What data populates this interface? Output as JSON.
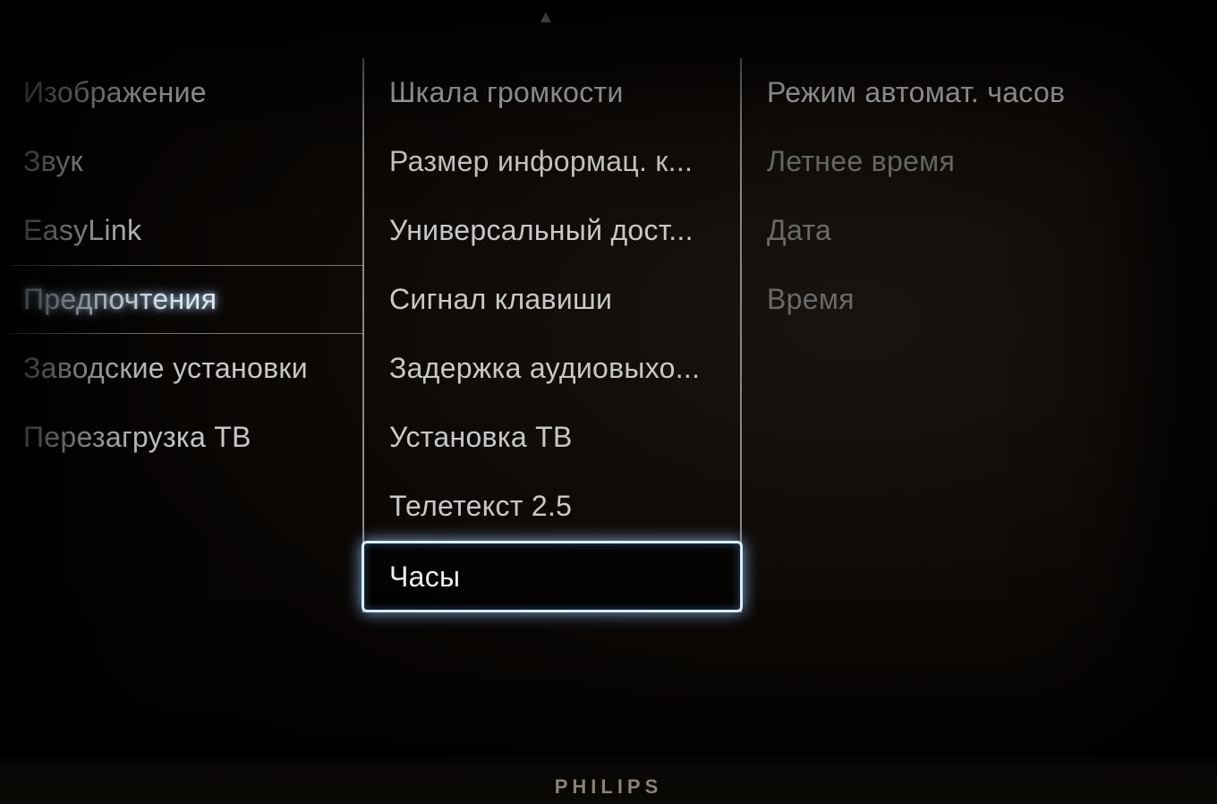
{
  "brand": "PHILIPS",
  "scroll_indicator": "▲",
  "columns": {
    "left": {
      "items": [
        {
          "label": "Изображение",
          "state": "normal"
        },
        {
          "label": "Звук",
          "state": "normal"
        },
        {
          "label": "EasyLink",
          "state": "normal"
        },
        {
          "label": "Предпочтения",
          "state": "active"
        },
        {
          "label": "Заводские установки",
          "state": "normal"
        },
        {
          "label": "Перезагрузка ТВ",
          "state": "normal"
        }
      ]
    },
    "middle": {
      "items": [
        {
          "label": "Шкала громкости",
          "state": "normal"
        },
        {
          "label": "Размер информац. к...",
          "state": "normal"
        },
        {
          "label": "Универсальный дост...",
          "state": "normal"
        },
        {
          "label": "Сигнал клавиши",
          "state": "normal"
        },
        {
          "label": "Задержка аудиовыхо...",
          "state": "normal"
        },
        {
          "label": "Установка ТВ",
          "state": "normal"
        },
        {
          "label": "Телетекст 2.5",
          "state": "normal"
        },
        {
          "label": "Часы",
          "state": "selected"
        }
      ]
    },
    "right": {
      "items": [
        {
          "label": "Режим автомат. часов",
          "state": "normal"
        },
        {
          "label": "Летнее время",
          "state": "dimmed"
        },
        {
          "label": "Дата",
          "state": "dimmed"
        },
        {
          "label": "Время",
          "state": "dimmed"
        }
      ]
    }
  }
}
